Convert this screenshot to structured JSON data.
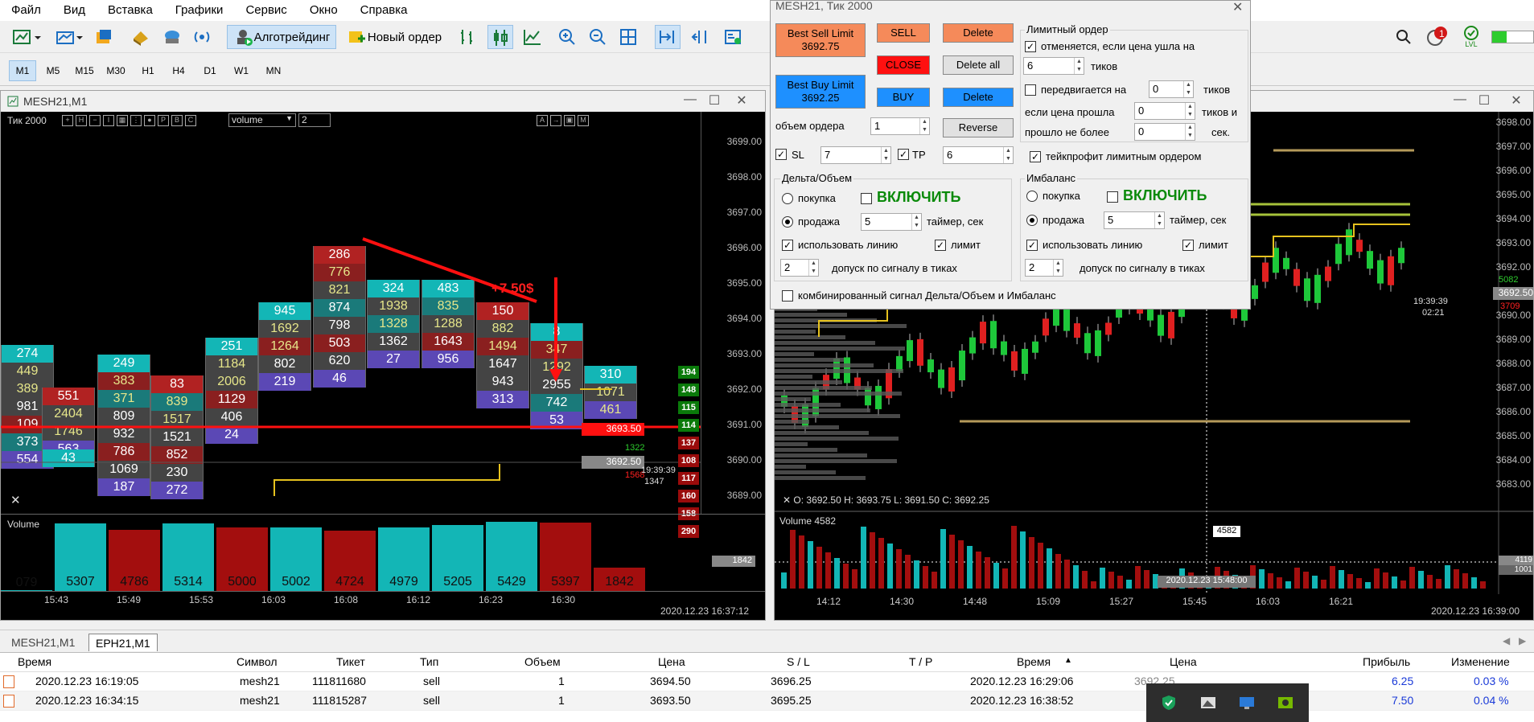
{
  "menu": [
    "Файл",
    "Вид",
    "Вставка",
    "Графики",
    "Сервис",
    "Окно",
    "Справка"
  ],
  "toolbar": {
    "algo_label": "Алготрейдинг",
    "new_order_label": "Новый ордер",
    "notif_count": "1",
    "lvl_label": "LVL"
  },
  "timeframes": [
    "M1",
    "M5",
    "M15",
    "M30",
    "H1",
    "H4",
    "D1",
    "W1",
    "MN"
  ],
  "left_chart": {
    "title": "MESH21,M1",
    "header": "Тик  2000",
    "select_value": "volume",
    "spin_value": "2",
    "annotation": "+7.50$",
    "price_labels": [
      "3699.00",
      "3698.00",
      "3697.00",
      "3696.00",
      "3695.00",
      "3694.00",
      "3693.00",
      "3692.00",
      "3691.00",
      "3690.00",
      "3689.00"
    ],
    "current_price": "3693.50",
    "last_price": "3692.50",
    "side_a": "1322",
    "side_b": "1568",
    "clock": "19:39:39",
    "clock2": "1347",
    "volume_title": "Volume",
    "volume_tag": "1842",
    "date_label": "2020.12.23 16:37:12",
    "x_labels": [
      "15:43",
      "15:49",
      "15:53",
      "16:03",
      "16:08",
      "16:12",
      "16:23",
      "16:30"
    ],
    "badges": [
      {
        "t": "194",
        "c": "#0a7a0a"
      },
      {
        "t": "148",
        "c": "#0a7a0a"
      },
      {
        "t": "115",
        "c": "#0a7a0a"
      },
      {
        "t": "114",
        "c": "#0a7a0a"
      },
      {
        "t": "137",
        "c": "#9a0b0b"
      },
      {
        "t": "108",
        "c": "#9a0b0b"
      },
      {
        "t": "117",
        "c": "#9a0b0b"
      },
      {
        "t": "160",
        "c": "#9a0b0b"
      },
      {
        "t": "158",
        "c": "#9a0b0b"
      },
      {
        "t": "290",
        "c": "#9a0b0b"
      }
    ],
    "footprint": [
      {
        "cells": [
          "274",
          "449",
          "389",
          "981",
          "109",
          "373",
          "554"
        ]
      },
      {
        "cells": [
          "551",
          "2404",
          "1746",
          "563"
        ]
      },
      {
        "cells": [
          "43"
        ]
      },
      {
        "cells": [
          "249",
          "383",
          "371",
          "809",
          "932",
          "786",
          "1069",
          "187"
        ]
      },
      {
        "cells": [
          "83",
          "839",
          "1517",
          "1521",
          "852",
          "230",
          "272"
        ]
      },
      {
        "cells": [
          "251",
          "1184",
          "2006",
          "1129",
          "406",
          "24"
        ]
      },
      {
        "cells": [
          "945",
          "1692",
          "1264",
          "802",
          "219"
        ]
      },
      {
        "cells": [
          "286",
          "776",
          "821",
          "874",
          "798",
          "503",
          "620",
          "46"
        ]
      },
      {
        "cells": [
          "324",
          "1938",
          "1328",
          "1362",
          "27"
        ]
      },
      {
        "cells": [
          "483",
          "835",
          "1288",
          "1643",
          "956"
        ]
      },
      {
        "cells": [
          "150",
          "882",
          "1494",
          "1647",
          "943",
          "313"
        ]
      },
      {
        "cells": [
          "8",
          "347",
          "1292",
          "2955",
          "742",
          "53"
        ]
      },
      {
        "cells": [
          "310",
          "1071",
          "461"
        ]
      }
    ],
    "volumes": [
      "079",
      "5307",
      "4786",
      "5314",
      "5000",
      "5002",
      "4724",
      "4979",
      "5205",
      "5429",
      "5397",
      "1842"
    ]
  },
  "right_chart": {
    "price_labels": [
      "3698.00",
      "3697.00",
      "3696.00",
      "3695.00",
      "3694.00",
      "3693.00",
      "3692.00",
      "3691.00",
      "3690.00",
      "3689.00",
      "3688.00",
      "3687.00",
      "3686.00",
      "3685.00",
      "3684.00",
      "3683.00"
    ],
    "current_price": "3692.50",
    "green_tag": "5082",
    "red_tag": "3709",
    "clock": "19:39:39",
    "clock2": "02:21",
    "ohlc": "O: 3692.50   H: 3693.75   L: 3691.50   C: 3692.25",
    "volume_title": "Volume 4582",
    "vol_tag": "4582",
    "vol_axis_a": "4119",
    "vol_axis_b": "1001",
    "date_tag": "2020.12.23 15:48:00",
    "date_label": "2020.12.23 16:39:00",
    "x_labels": [
      "14:12",
      "14:30",
      "14:48",
      "15:09",
      "15:27",
      "15:45",
      "16:03",
      "16:21"
    ]
  },
  "dialog": {
    "title": "MESH21, Тик  2000",
    "best_sell": "Best Sell Limit\n3692.75",
    "best_buy": "Best Buy Limit\n3692.25",
    "sell": "SELL",
    "close": "CLOSE",
    "buy": "BUY",
    "delete1": "Delete",
    "delete_all": "Delete all",
    "delete2": "Delete",
    "reverse": "Reverse",
    "volume_label": "объем ордера",
    "volume_value": "1",
    "sl_label": "SL",
    "sl_value": "7",
    "tp_label": "TP",
    "tp_value": "6",
    "limit_group": "Лимитный ордер",
    "cancel_label": "отменяется, если цена ушла на",
    "cancel_value": "6",
    "ticks": "тиков",
    "moves_label": "передвигается на",
    "moves_value": "0",
    "ticks2": "тиков",
    "if_passed": "если цена прошла",
    "if_passed_value": "0",
    "ticks_and": "тиков и",
    "no_more": "прошло не более",
    "no_more_value": "0",
    "sec": "сек.",
    "tp_limit": "тейкпрофит лимитным ордером",
    "delta_group": "Дельта/Объем",
    "imb_group": "Имбаланс",
    "buy_radio": "покупка",
    "sell_radio": "продажа",
    "enable": "ВКЛЮЧИТЬ",
    "timer_value": "5",
    "timer_label": "таймер, сек",
    "use_line": "использовать линию",
    "limit": "лимит",
    "tolerance_value": "2",
    "tolerance_label": "допуск по сигналу в тиках",
    "combined": "комбинированный сигнал Дельта/Объем и Имбаланс"
  },
  "tabs": [
    "MESH21,M1",
    "EPH21,M1"
  ],
  "table": {
    "headers": [
      "Время",
      "Символ",
      "Тикет",
      "Тип",
      "Объем",
      "Цена",
      "S / L",
      "T / P",
      "Время",
      "Цена",
      "Прибыль",
      "Изменение"
    ],
    "rows": [
      [
        "2020.12.23 16:19:05",
        "mesh21",
        "111811680",
        "sell",
        "1",
        "3694.50",
        "3696.25",
        "",
        "2020.12.23 16:29:06",
        "3692.25",
        "6.25",
        "0.03 %"
      ],
      [
        "2020.12.23 16:34:15",
        "mesh21",
        "111815287",
        "sell",
        "1",
        "3693.50",
        "3695.25",
        "",
        "2020.12.23 16:38:52",
        "",
        "7.50",
        "0.04 %"
      ]
    ]
  },
  "colors": {
    "teal": "#13b6b6",
    "darkred": "#a30e0e",
    "yellow": "#e6c21e",
    "sell_orange": "#f58a5a",
    "buy_blue": "#1e90ff",
    "close_red": "#ff1010"
  }
}
